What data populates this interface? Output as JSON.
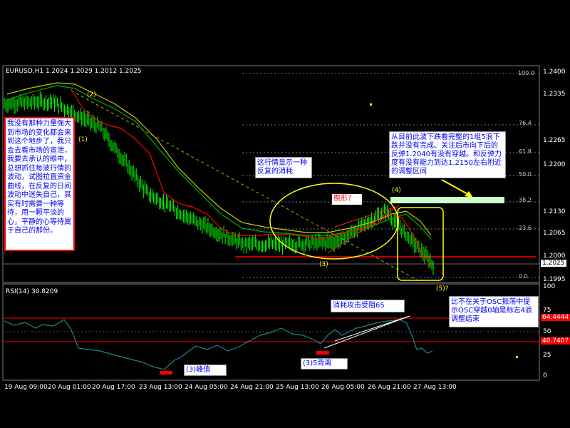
{
  "window": {
    "symbol_info": "EURUSD,H1  1.2024 1.2029 1.2012 1.2025",
    "rsi_label": "RSI(14)  30.8209"
  },
  "price_axis": {
    "ticks": [
      "1.2400",
      "1.2335",
      "1.2265",
      "1.2200",
      "1.2130",
      "1.2065",
      "1.2000",
      "1.1995"
    ],
    "current_price": "1.2025"
  },
  "rsi_axis": {
    "ticks": [
      "100",
      "75",
      "50",
      "25",
      "0"
    ],
    "level_high": "64.4444",
    "level_low": "40.7407"
  },
  "fib_levels": [
    "100.0",
    "76.4",
    "61.8",
    "50.0",
    "38.2",
    "23.6",
    "0.0"
  ],
  "time_axis": [
    "19 Aug 09:00",
    "20 Aug 01:00",
    "20 Aug 17:00",
    "23 Aug 13:00",
    "24 Aug 05:00",
    "24 Aug 21:00",
    "25 Aug 13:00",
    "26 Aug 05:00",
    "26 Aug 21:00",
    "27 Aug 13:00"
  ],
  "wave_labels": {
    "w1": "(1)",
    "w2": "(2)",
    "w3": "(3)",
    "w4": "(4)",
    "w5": "(5)?"
  },
  "annotations": {
    "left_note": "我没有那种力量强大到市场的变化都会来到这个地步了，我只会去看市场的宣泄，我要去承认的眼中，总想抓住每波行情的波动，试图拉直资金曲线，在反复的日间波动中迷失自己，其实有时需要一种等待，用一颗平淡的心，平静的心等待属于自己的那份。",
    "consumption_note": "这行情显示一种反复的消耗",
    "wedge_label": "楔形？",
    "wave4_note": "从目前此波下跌看完整的1组5浪下跌并没有完成。关注后市向下后的反弹1.2040有没有穿越。和反弹力度有没有能力到达1.2150左右附近的调整区间",
    "rsi_note_consumption": "消耗攻击受阻65",
    "rsi_peak": "(3)峰值",
    "rsi_divergence": "(3)5背离",
    "osc_note": "比不在关于OSC振荡中提示OSC穿越0轴是标志4浪调整结束"
  },
  "colors": {
    "candle": "#00ff00",
    "ma_red": "#ff0000",
    "ma_yellow": "#ffff00",
    "ma_green": "#00aa00",
    "rsi_line": "#1a8a8a",
    "level_red": "#ff0000",
    "note_text": "#0000ff",
    "accent_yellow": "#ffff00"
  },
  "chart_data": [
    {
      "type": "line",
      "title": "EURUSD,H1",
      "ylim": [
        1.1985,
        1.241
      ],
      "series": [
        {
          "name": "EURUSD",
          "x": [
            "19 Aug 09:00",
            "20 Aug 01:00",
            "20 Aug 17:00",
            "23 Aug 13:00",
            "24 Aug 05:00",
            "24 Aug 21:00",
            "25 Aug 13:00",
            "26 Aug 05:00",
            "26 Aug 21:00",
            "27 Aug 13:00"
          ],
          "values": [
            1.2335,
            1.234,
            1.229,
            1.216,
            1.2105,
            1.206,
            1.206,
            1.2065,
            1.2125,
            1.202
          ]
        }
      ]
    },
    {
      "type": "line",
      "title": "RSI(14)",
      "ylim": [
        0,
        100
      ],
      "series": [
        {
          "name": "RSI(14)",
          "x": [
            "19 Aug 09:00",
            "20 Aug 01:00",
            "20 Aug 17:00",
            "23 Aug 13:00",
            "24 Aug 05:00",
            "24 Aug 21:00",
            "25 Aug 13:00",
            "26 Aug 05:00",
            "26 Aug 21:00",
            "27 Aug 13:00"
          ],
          "values": [
            55,
            58,
            40,
            20,
            30,
            43,
            45,
            35,
            60,
            31
          ]
        }
      ]
    }
  ]
}
